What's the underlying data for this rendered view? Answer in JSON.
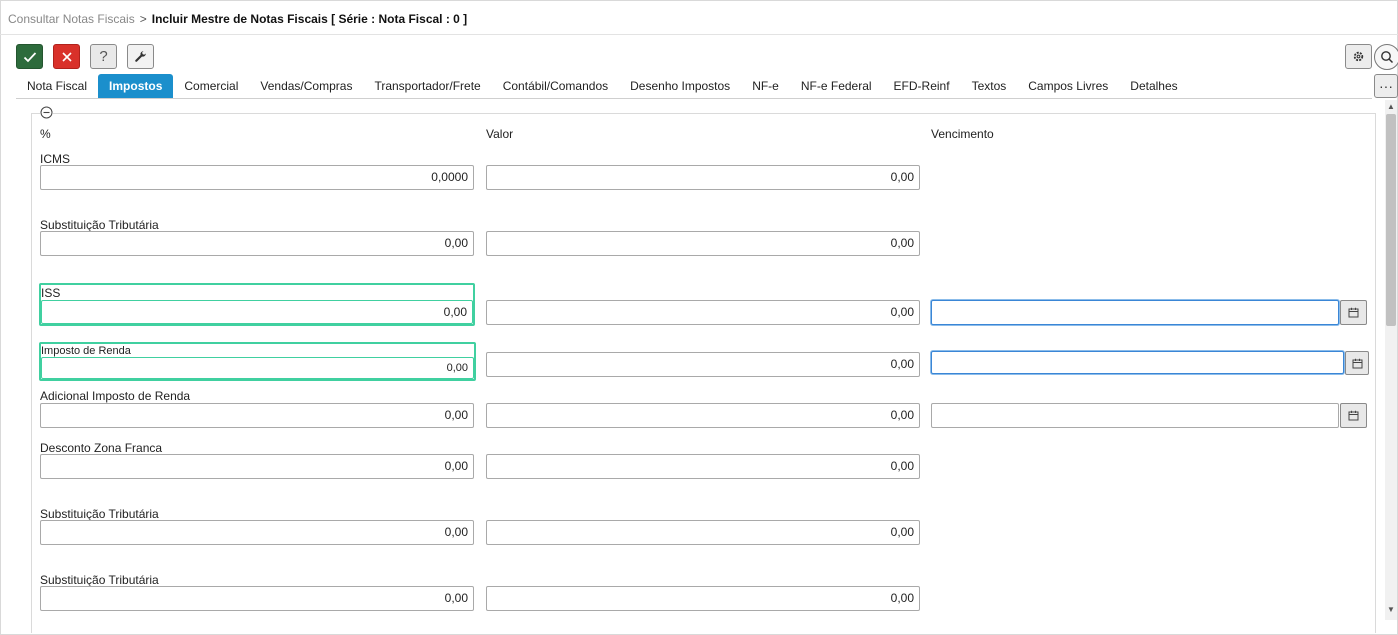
{
  "breadcrumb": {
    "parent": "Consultar Notas Fiscais",
    "separator": ">",
    "current": "Incluir Mestre de Notas Fiscais [ Série : Nota Fiscal : 0 ]"
  },
  "toolbar": {
    "ok_icon": "checkmark-icon",
    "cancel_icon": "x-icon",
    "help_label": "?",
    "tool_icon": "wrench-icon",
    "gear_icon": "gear-icon",
    "search_icon": "search-icon",
    "more_label": "···"
  },
  "tabs": [
    {
      "label": "Nota Fiscal",
      "active": false
    },
    {
      "label": "Impostos",
      "active": true
    },
    {
      "label": "Comercial",
      "active": false
    },
    {
      "label": "Vendas/Compras",
      "active": false
    },
    {
      "label": "Transportador/Frete",
      "active": false
    },
    {
      "label": "Contábil/Comandos",
      "active": false
    },
    {
      "label": "Desenho Impostos",
      "active": false
    },
    {
      "label": "NF-e",
      "active": false
    },
    {
      "label": "NF-e Federal",
      "active": false
    },
    {
      "label": "EFD-Reinf",
      "active": false
    },
    {
      "label": "Textos",
      "active": false
    },
    {
      "label": "Campos Livres",
      "active": false
    },
    {
      "label": "Detalhes",
      "active": false
    }
  ],
  "columns": {
    "percent": "%",
    "value": "Valor",
    "due": "Vencimento"
  },
  "rows": [
    {
      "label": "ICMS",
      "percent": "0,0000",
      "value": "0,00"
    },
    {
      "label": "Substituição Tributária",
      "percent": "0,00",
      "value": "0,00"
    },
    {
      "label": "ISS",
      "percent": "0,00",
      "value": "0,00",
      "due": ""
    },
    {
      "label": "Imposto de Renda",
      "percent": "0,00",
      "value": "0,00",
      "due": ""
    },
    {
      "label": "Adicional Imposto de Renda",
      "percent": "0,00",
      "value": "0,00",
      "due": ""
    },
    {
      "label": "Desconto Zona Franca",
      "percent": "0,00",
      "value": "0,00"
    },
    {
      "label": "Substituição Tributária",
      "percent": "0,00",
      "value": "0,00"
    },
    {
      "label": "Substituição Tributária",
      "percent": "0,00",
      "value": "0,00"
    }
  ],
  "colors": {
    "accent_tab": "#1b8fcc",
    "ok_button": "#2d6b3c",
    "cancel_button": "#d9312a",
    "highlight_green": "#40d0a0",
    "focus_blue": "#3a86d6"
  }
}
